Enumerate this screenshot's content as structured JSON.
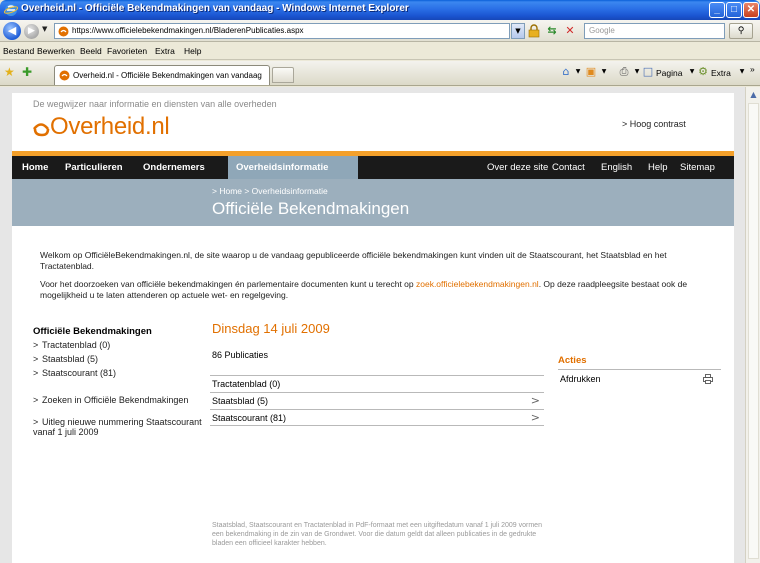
{
  "window": {
    "title": "Overheid.nl - Officiële Bekendmakingen van vandaag - Windows Internet Explorer",
    "min_label": "_",
    "max_label": "□",
    "close_label": "✕"
  },
  "addressbar": {
    "url": "https://www.officielebekendmakingen.nl/BladerenPublicaties.aspx",
    "search_placeholder": "Google"
  },
  "menu": [
    "Bestand",
    "Bewerken",
    "Beeld",
    "Favorieten",
    "Extra",
    "Help"
  ],
  "tab": {
    "label": "Overheid.nl - Officiële Bekendmakingen van vandaag"
  },
  "commands": {
    "page": "Pagina",
    "extra": "Extra",
    "overflow": "»"
  },
  "site": {
    "tagline": "De wegwijzer naar informatie en diensten van alle overheden",
    "logo_text": "Overheid.nl",
    "hoog_contrast": "> Hoog contrast",
    "nav_left": [
      "Home",
      "Particulieren",
      "Ondernemers",
      "Overheidsinformatie"
    ],
    "nav_right": [
      "Over deze site",
      "Contact",
      "English",
      "Help",
      "Sitemap"
    ],
    "breadcrumb": "> Home  > Overheidsinformatie",
    "page_title": "Officiële Bekendmakingen",
    "intro1": "Welkom op OfficiëleBekendmakingen.nl, de site waarop u de vandaag gepubliceerde officiële bekendmakingen kunt vinden uit de Staatscourant, het Staatsblad en het Tractatenblad.",
    "intro2_pre": "Voor het doorzoeken van officiële bekendmakingen én parlementaire documenten kunt u terecht op ",
    "intro2_link": "zoek.officielebekendmakingen.nl",
    "intro2_post": ". Op deze raadpleegsite bestaat ook de mogelijkheid u te laten attenderen op actuele wet- en regelgeving."
  },
  "sidebar": {
    "title": "Officiële Bekendmakingen",
    "links": [
      "Tractatenblad (0)",
      "Staatsblad (5)",
      "Staatscourant (81)"
    ],
    "links2": [
      "Zoeken in Officiële Bekendmakingen",
      "Uitleg nieuwe nummering Staatscourant vanaf 1 juli 2009"
    ],
    "chevron": ">"
  },
  "main": {
    "date": "Dinsdag 14 juli 2009",
    "count": "86 Publicaties",
    "rows": [
      {
        "label": "Tractatenblad (0)",
        "chevron": ""
      },
      {
        "label": "Staatsblad (5)",
        "chevron": ">"
      },
      {
        "label": "Staatscourant (81)",
        "chevron": ">"
      }
    ],
    "footnote": "Staatsblad, Staatscourant en Tractatenblad in PdF-formaat met een uitgiftedatum vanaf 1 juli 2009 vormen een bekendmaking in de zin van de Grondwet. Voor die datum geldt dat alleen publicaties in de gedrukte bladen een officieel karakter hebben."
  },
  "acties": {
    "title": "Acties",
    "print_label": "Afdrukken"
  },
  "colors": {
    "brand_orange": "#e17000",
    "nav_black": "#1a1a1a",
    "banner_blue": "#9cafbd"
  }
}
